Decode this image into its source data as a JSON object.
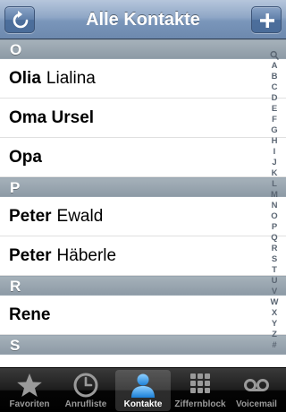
{
  "navbar": {
    "title": "Alle Kontakte",
    "left_icon": "refresh-icon",
    "right_icon": "plus-icon"
  },
  "sections": [
    {
      "letter": "O",
      "contacts": [
        {
          "first": "Olia",
          "last": "Lialina"
        },
        {
          "first": "Oma Ursel",
          "last": ""
        },
        {
          "first": "Opa",
          "last": ""
        }
      ]
    },
    {
      "letter": "P",
      "contacts": [
        {
          "first": "Peter",
          "last": "Ewald"
        },
        {
          "first": "Peter",
          "last": "Häberle"
        }
      ]
    },
    {
      "letter": "R",
      "contacts": [
        {
          "first": "Rene",
          "last": ""
        }
      ]
    },
    {
      "letter": "S",
      "contacts": []
    }
  ],
  "index": [
    "A",
    "B",
    "C",
    "D",
    "E",
    "F",
    "G",
    "H",
    "I",
    "J",
    "K",
    "L",
    "M",
    "N",
    "O",
    "P",
    "Q",
    "R",
    "S",
    "T",
    "U",
    "V",
    "W",
    "X",
    "Y",
    "Z",
    "#"
  ],
  "tabs": [
    {
      "label": "Favoriten",
      "icon": "star-icon",
      "active": false
    },
    {
      "label": "Anrufliste",
      "icon": "clock-icon",
      "active": false
    },
    {
      "label": "Kontakte",
      "icon": "person-icon",
      "active": true
    },
    {
      "label": "Ziffernblock",
      "icon": "keypad-icon",
      "active": false
    },
    {
      "label": "Voicemail",
      "icon": "voicemail-icon",
      "active": false
    }
  ],
  "colors": {
    "nav_blue": "#6d89ae",
    "section_gray": "#97a3ae",
    "active_tab_blue": "#3aa3e8"
  }
}
